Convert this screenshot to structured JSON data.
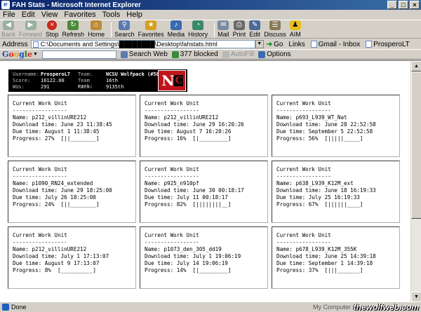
{
  "window": {
    "title": "FAH Stats - Microsoft Internet Explorer",
    "controls": [
      "_",
      "□",
      "×"
    ]
  },
  "menu": [
    "File",
    "Edit",
    "View",
    "Favorites",
    "Tools",
    "Help"
  ],
  "toolbar": {
    "back": "Back",
    "forward": "Forward",
    "stop": "Stop",
    "refresh": "Refresh",
    "home": "Home",
    "search": "Search",
    "favorites": "Favorites",
    "media": "Media",
    "history": "History",
    "mail": "Mail",
    "print": "Print",
    "edit": "Edit",
    "discuss": "Discuss",
    "aim": "AIM"
  },
  "address": {
    "label": "Address",
    "value": "C:\\Documents and Settings\\████████\\Desktop\\fahstats.html",
    "go": "Go",
    "links_label": "Links",
    "links": [
      "Gmail - Inbox",
      "ProsperoLT"
    ]
  },
  "google": {
    "logo": [
      "G",
      "o",
      "o",
      "g",
      "l",
      "e"
    ],
    "search_web": "Search Web",
    "blocked": "377 blocked",
    "autofill": "AutoFill",
    "options": "Options"
  },
  "stats": {
    "username_label": "Username:",
    "username": "ProsperoLT",
    "team_label": "Team:",
    "team": "NCSU Wolfpack (#50)",
    "score_label": "Score:",
    "score": "16122.00",
    "team_rank_label": "Team rank:",
    "team_rank": "16th",
    "wus_label": "WUs:",
    "wus": "291",
    "rank_label": "Rank:",
    "rank": "9135th",
    "logo_letter": "N",
    "logo_letter2": "C"
  },
  "card_header": "Current Work Unit",
  "card_rule": "-----------------",
  "labels": {
    "name": "Name: ",
    "download": "Download time: ",
    "due": "Due time: ",
    "progress": "Progress: "
  },
  "units": [
    {
      "name": "p212_villinURE212",
      "download": "June 23 11:38:45",
      "due": "August 1 11:38:45",
      "progress": "27%",
      "progress_fraction": 0.27,
      "bar": "[||________]"
    },
    {
      "name": "p212_villinURE212",
      "download": "June 29 16:20:26",
      "due": "August 7 16:20:26",
      "progress": "16%",
      "progress_fraction": 0.16,
      "bar": "[|_________]"
    },
    {
      "name": "p693_L939_WT_Nat",
      "download": "June 28 22:52:58",
      "due": "September 5 22:52:58",
      "progress": "56%",
      "progress_fraction": 0.56,
      "bar": "[|||||_____]"
    },
    {
      "name": "p1090_RN24_extended",
      "download": "June 29 18:25:00",
      "due": "July 26 18:25:00",
      "progress": "24%",
      "progress_fraction": 0.24,
      "bar": "[||________]"
    },
    {
      "name": "p925_n910pf",
      "download": "June 30 00:18:17",
      "due": "July 11 00:18:17",
      "progress": "82%",
      "progress_fraction": 0.82,
      "bar": "[||||||||__]"
    },
    {
      "name": "p638_L939_K12M_ext",
      "download": "June 18 16:19:33",
      "due": "July 25 16:19:33",
      "progress": "67%",
      "progress_fraction": 0.67,
      "bar": "[||||||____]"
    },
    {
      "name": "p212_villinURE212",
      "download": "July 1 17:13:07",
      "due": "August 9 17:13:07",
      "progress": "8%",
      "progress_fraction": 0.08,
      "bar": "[__________]"
    },
    {
      "name": "p1073_den_305_dd19",
      "download": "July 1 19:06:19",
      "due": "July 14 19:06:19",
      "progress": "14%",
      "progress_fraction": 0.14,
      "bar": "[|_________]"
    },
    {
      "name": "p678_L939_K12M_355K",
      "download": "June 25 14:39:18",
      "due": "September 1 14:39:18",
      "progress": "37%",
      "progress_fraction": 0.37,
      "bar": "[|||_______]"
    }
  ],
  "status": {
    "text": "Done",
    "zone": "My Computer",
    "watermark": "thewolfweb.com"
  }
}
